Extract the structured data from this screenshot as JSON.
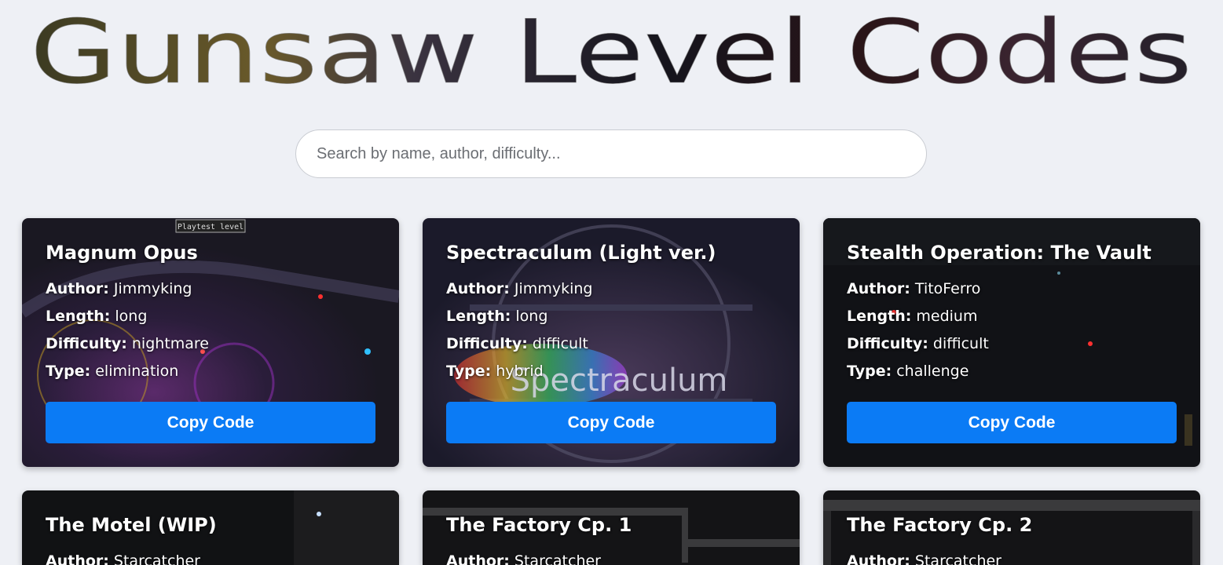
{
  "site": {
    "title": "Gunsaw Level Codes"
  },
  "search": {
    "placeholder": "Search by name, author, difficulty..."
  },
  "labels": {
    "author": "Author:",
    "length": "Length:",
    "difficulty": "Difficulty:",
    "type": "Type:",
    "copy": "Copy Code"
  },
  "levels": [
    {
      "name": "Magnum Opus",
      "author": "Jimmyking",
      "length": "long",
      "difficulty": "nightmare",
      "type": "elimination",
      "overlay": "Playtest level"
    },
    {
      "name": "Spectraculum (Light ver.)",
      "author": "Jimmyking",
      "length": "long",
      "difficulty": "difficult",
      "type": "hybrid",
      "overlay": "Spectraculum"
    },
    {
      "name": "Stealth Operation: The Vault",
      "author": "TitoFerro",
      "length": "medium",
      "difficulty": "difficult",
      "type": "challenge"
    },
    {
      "name": "The Motel (WIP)",
      "author": "Starcatcher"
    },
    {
      "name": "The Factory Cp. 1",
      "author": "Starcatcher"
    },
    {
      "name": "The Factory Cp. 2",
      "author": "Starcatcher"
    }
  ],
  "colors": {
    "accent": "#0b7bf5",
    "page_bg": "#eef0f5"
  }
}
